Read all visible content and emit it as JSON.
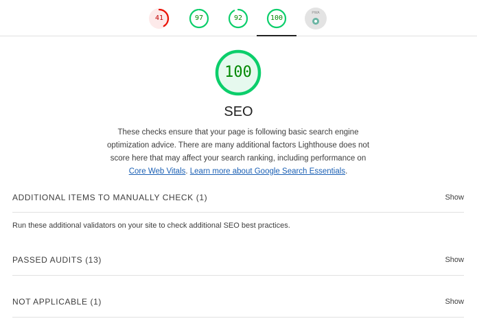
{
  "tabs": [
    {
      "score": "41",
      "status": "fail",
      "color": "#eb0f00",
      "bg": "#fdeaea",
      "fraction": 0.41
    },
    {
      "score": "97",
      "status": "pass",
      "color": "#0cce6b",
      "bg": "#ffffff",
      "fraction": 0.97
    },
    {
      "score": "92",
      "status": "pass",
      "color": "#0cce6b",
      "bg": "#ffffff",
      "fraction": 0.92
    },
    {
      "score": "100",
      "status": "pass",
      "color": "#0cce6b",
      "bg": "#ffffff",
      "fraction": 1.0
    }
  ],
  "pwa": {
    "label": "PWA",
    "icon": "pwa-badge-icon"
  },
  "category": {
    "score": "100",
    "score_fraction": 1.0,
    "title": "SEO",
    "description_part1": "These checks ensure that your page is following basic search engine optimization advice. There are many additional factors Lighthouse does not score here that may affect your search ranking, including performance on",
    "link1": "Core Web Vitals",
    "separator": ". ",
    "link2": "Learn more about Google Search Essentials",
    "end": ".",
    "ring_color": "#0cce6b",
    "fill_color": "#e6f9ee",
    "text_color": "#008800"
  },
  "sections": {
    "manual": {
      "title": "ADDITIONAL ITEMS TO MANUALLY CHECK (1)",
      "show": "Show",
      "description": "Run these additional validators on your site to check additional SEO best practices."
    },
    "passed": {
      "title": "PASSED AUDITS (13)",
      "show": "Show"
    },
    "na": {
      "title": "NOT APPLICABLE (1)",
      "show": "Show"
    }
  }
}
